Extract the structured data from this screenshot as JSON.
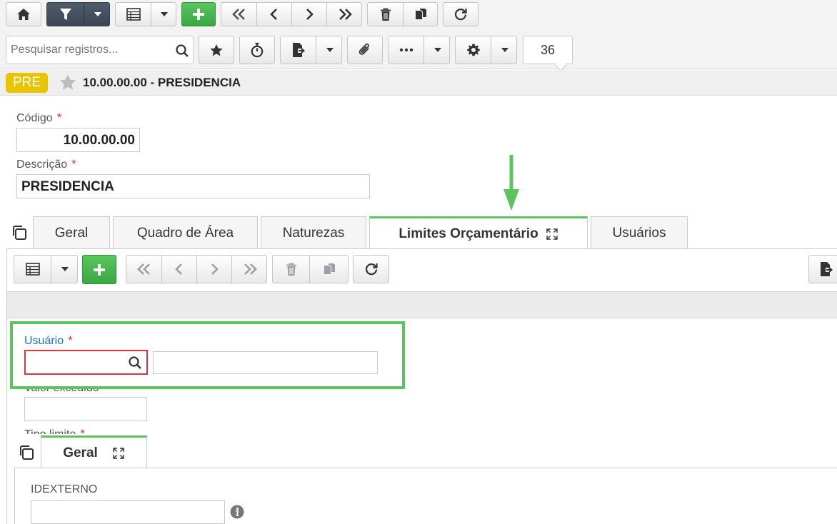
{
  "toolbar": {
    "search_placeholder": "Pesquisar registros...",
    "counter": "36"
  },
  "record": {
    "badge": "PRE",
    "title": "10.00.00.00 - PRESIDENCIA"
  },
  "form": {
    "codigo_label": "Código",
    "codigo_value": "10.00.00.00",
    "descricao_label": "Descrição",
    "descricao_value": "PRESIDENCIA",
    "required_mark": "*"
  },
  "tabs": [
    {
      "label": "Geral"
    },
    {
      "label": "Quadro de Área"
    },
    {
      "label": "Naturezas"
    },
    {
      "label": "Limites Orçamentário",
      "active": true
    },
    {
      "label": "Usuários"
    }
  ],
  "sub_form": {
    "usuario_label": "Usuário",
    "valor_label": "Valor excedido",
    "tipo_label": "Tipo limite"
  },
  "bottom_tabs": [
    {
      "label": "Geral",
      "active": true
    }
  ],
  "bottom_form": {
    "idexterno_label": "IDEXTERNO"
  },
  "colors": {
    "accent_green": "#5cc45f",
    "badge_yellow": "#e9c400",
    "required_red": "#d9363e",
    "error_red": "#d9363e",
    "link_blue": "#1a6fc6"
  }
}
